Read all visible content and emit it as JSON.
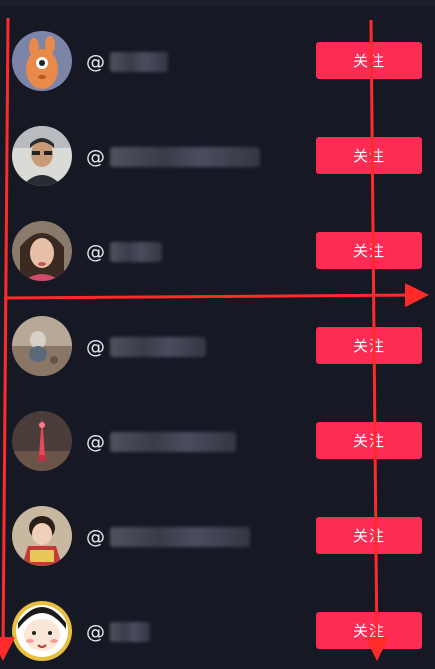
{
  "accent_color": "#fe2c55",
  "background_color": "#161824",
  "follow_label": "关注",
  "users": [
    {
      "name_prefix": "@"
    },
    {
      "name_prefix": "@"
    },
    {
      "name_prefix": "@"
    },
    {
      "name_prefix": "@"
    },
    {
      "name_prefix": "@"
    },
    {
      "name_prefix": "@"
    },
    {
      "name_prefix": "@"
    }
  ],
  "annotation_color": "#ff2a2a"
}
